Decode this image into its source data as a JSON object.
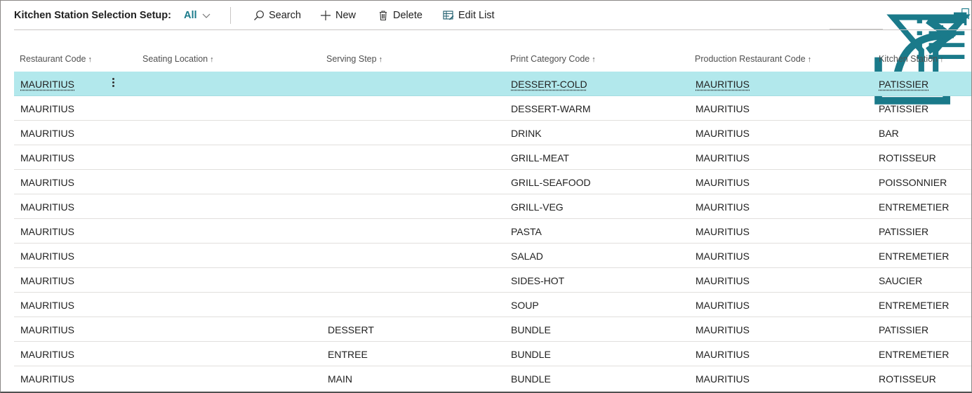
{
  "toolbar": {
    "title": "Kitchen Station Selection Setup:",
    "filter_label": "All",
    "search_label": "Search",
    "new_label": "New",
    "delete_label": "Delete",
    "edit_list_label": "Edit List",
    "accent_color": "#1a7a8a"
  },
  "columns": [
    {
      "label": "Restaurant Code",
      "sort": "↑"
    },
    {
      "label": "Seating Location",
      "sort": "↑"
    },
    {
      "label": "Serving Step",
      "sort": "↑"
    },
    {
      "label": "Print Category Code",
      "sort": "↑"
    },
    {
      "label": "Production Restaurant Code",
      "sort": "↑"
    },
    {
      "label": "Kitchen Station",
      "sort": "↑"
    }
  ],
  "rows": [
    {
      "restaurant": "MAURITIUS",
      "seating": "",
      "step": "",
      "category": "DESSERT-COLD",
      "production": "MAURITIUS",
      "station": "PATISSIER"
    },
    {
      "restaurant": "MAURITIUS",
      "seating": "",
      "step": "",
      "category": "DESSERT-WARM",
      "production": "MAURITIUS",
      "station": "PATISSIER"
    },
    {
      "restaurant": "MAURITIUS",
      "seating": "",
      "step": "",
      "category": "DRINK",
      "production": "MAURITIUS",
      "station": "BAR"
    },
    {
      "restaurant": "MAURITIUS",
      "seating": "",
      "step": "",
      "category": "GRILL-MEAT",
      "production": "MAURITIUS",
      "station": "ROTISSEUR"
    },
    {
      "restaurant": "MAURITIUS",
      "seating": "",
      "step": "",
      "category": "GRILL-SEAFOOD",
      "production": "MAURITIUS",
      "station": "POISSONNIER"
    },
    {
      "restaurant": "MAURITIUS",
      "seating": "",
      "step": "",
      "category": "GRILL-VEG",
      "production": "MAURITIUS",
      "station": "ENTREMETIER"
    },
    {
      "restaurant": "MAURITIUS",
      "seating": "",
      "step": "",
      "category": "PASTA",
      "production": "MAURITIUS",
      "station": "PATISSIER"
    },
    {
      "restaurant": "MAURITIUS",
      "seating": "",
      "step": "",
      "category": "SALAD",
      "production": "MAURITIUS",
      "station": "ENTREMETIER"
    },
    {
      "restaurant": "MAURITIUS",
      "seating": "",
      "step": "",
      "category": "SIDES-HOT",
      "production": "MAURITIUS",
      "station": "SAUCIER"
    },
    {
      "restaurant": "MAURITIUS",
      "seating": "",
      "step": "",
      "category": "SOUP",
      "production": "MAURITIUS",
      "station": "ENTREMETIER"
    },
    {
      "restaurant": "MAURITIUS",
      "seating": "",
      "step": "DESSERT",
      "category": "BUNDLE",
      "production": "MAURITIUS",
      "station": "PATISSIER"
    },
    {
      "restaurant": "MAURITIUS",
      "seating": "",
      "step": "ENTREE",
      "category": "BUNDLE",
      "production": "MAURITIUS",
      "station": "ENTREMETIER"
    },
    {
      "restaurant": "MAURITIUS",
      "seating": "",
      "step": "MAIN",
      "category": "BUNDLE",
      "production": "MAURITIUS",
      "station": "ROTISSEUR"
    }
  ],
  "selection_color": "#b2e8ec"
}
